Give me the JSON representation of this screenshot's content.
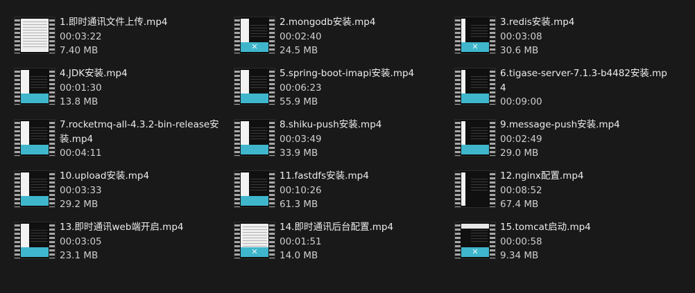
{
  "files": [
    {
      "name": "1.即时通讯文件上传.mp4",
      "duration": "00:03:22",
      "size": "7.40 MB",
      "thumb": "light"
    },
    {
      "name": "2.mongodb安装.mp4",
      "duration": "00:02:40",
      "size": "24.5 MB",
      "thumb": "dark-cyan"
    },
    {
      "name": "3.redis安装.mp4",
      "duration": "00:03:08",
      "size": "30.6 MB",
      "thumb": "dark-cyan"
    },
    {
      "name": "4.JDK安装.mp4",
      "duration": "00:01:30",
      "size": "13.8 MB",
      "thumb": "dark-cyan"
    },
    {
      "name": "5.spring-boot-imapi安装.mp4",
      "duration": "00:06:23",
      "size": "55.9 MB",
      "thumb": "dark-cyan"
    },
    {
      "name": "6.tigase-server-7.1.3-b4482安装.mp4",
      "duration": "00:09:00",
      "size": "",
      "thumb": "dark-cyan"
    },
    {
      "name": "7.rocketmq-all-4.3.2-bin-release安装.mp4",
      "duration": "00:04:11",
      "size": "",
      "thumb": "dark-cyan"
    },
    {
      "name": "8.shiku-push安装.mp4",
      "duration": "00:03:49",
      "size": "33.9 MB",
      "thumb": "dark-cyan"
    },
    {
      "name": "9.message-push安装.mp4",
      "duration": "00:02:49",
      "size": "29.0 MB",
      "thumb": "dark-cyan"
    },
    {
      "name": "10.upload安装.mp4",
      "duration": "00:03:33",
      "size": "29.2 MB",
      "thumb": "dark-cyan"
    },
    {
      "name": "11.fastdfs安装.mp4",
      "duration": "00:10:26",
      "size": "61.3 MB",
      "thumb": "dark-cyan"
    },
    {
      "name": "12.nginx配置.mp4",
      "duration": "00:08:52",
      "size": "67.4 MB",
      "thumb": "dark-cyan"
    },
    {
      "name": "13.即时通讯web端开启.mp4",
      "duration": "00:03:05",
      "size": "23.1 MB",
      "thumb": "dark-cyan"
    },
    {
      "name": "14.即时通讯后台配置.mp4",
      "duration": "00:01:51",
      "size": "14.0 MB",
      "thumb": "light-cyan"
    },
    {
      "name": "15.tomcat启动.mp4",
      "duration": "00:00:58",
      "size": "9.34 MB",
      "thumb": "dark-cyan"
    }
  ],
  "colors": {
    "background": "#191919",
    "accent": "#3fb6cc",
    "text": "#e2e2e2"
  },
  "icons": {
    "thumbnail": "video-film-icon",
    "overlay": "x-mark-icon"
  }
}
